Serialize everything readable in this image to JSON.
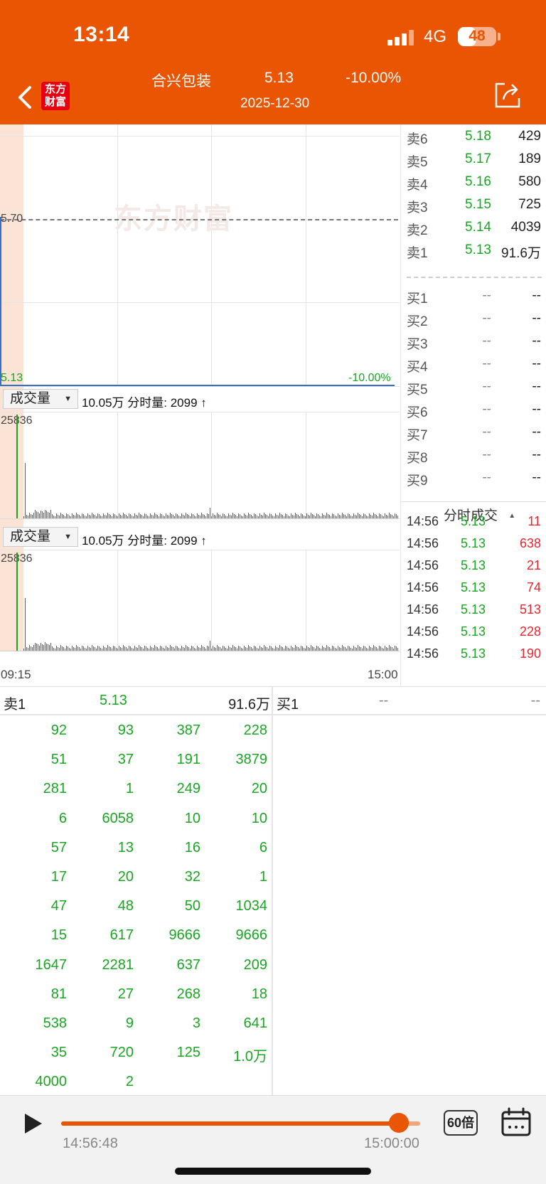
{
  "status": {
    "time": "13:14",
    "network": "4G",
    "battery": "48"
  },
  "header": {
    "logo": "东方财富",
    "stock_name": "合兴包装",
    "price": "5.13",
    "change_pct": "-10.00%",
    "date": "2025-12-30"
  },
  "chart": {
    "watermark": "东方财富",
    "price_high_label": "5.70",
    "price_low_label": "5.13",
    "pct_low_label": "-10.00%",
    "vol_select_label": "成交量",
    "vol_info": "10.05万 分时量: 2099 ↑",
    "vol_max_label": "25836",
    "time_start": "09:15",
    "time_end": "15:00"
  },
  "order_book": {
    "asks": [
      {
        "label": "卖6",
        "price": "5.18",
        "vol": "429"
      },
      {
        "label": "卖5",
        "price": "5.17",
        "vol": "189"
      },
      {
        "label": "卖4",
        "price": "5.16",
        "vol": "580"
      },
      {
        "label": "卖3",
        "price": "5.15",
        "vol": "725"
      },
      {
        "label": "卖2",
        "price": "5.14",
        "vol": "4039"
      },
      {
        "label": "卖1",
        "price": "5.13",
        "vol": "91.6万"
      }
    ],
    "bids": [
      {
        "label": "买1",
        "price": "--",
        "vol": "--"
      },
      {
        "label": "买2",
        "price": "--",
        "vol": "--"
      },
      {
        "label": "买3",
        "price": "--",
        "vol": "--"
      },
      {
        "label": "买4",
        "price": "--",
        "vol": "--"
      },
      {
        "label": "买5",
        "price": "--",
        "vol": "--"
      },
      {
        "label": "买6",
        "price": "--",
        "vol": "--"
      },
      {
        "label": "买7",
        "price": "--",
        "vol": "--"
      },
      {
        "label": "买8",
        "price": "--",
        "vol": "--"
      },
      {
        "label": "买9",
        "price": "--",
        "vol": "--"
      }
    ]
  },
  "trades": {
    "title": "分时成交",
    "rows": [
      {
        "time": "14:56",
        "price": "5.13",
        "vol": "11"
      },
      {
        "time": "14:56",
        "price": "5.13",
        "vol": "638"
      },
      {
        "time": "14:56",
        "price": "5.13",
        "vol": "21"
      },
      {
        "time": "14:56",
        "price": "5.13",
        "vol": "74"
      },
      {
        "time": "14:56",
        "price": "5.13",
        "vol": "513"
      },
      {
        "time": "14:56",
        "price": "5.13",
        "vol": "228"
      },
      {
        "time": "14:56",
        "price": "5.13",
        "vol": "190"
      }
    ]
  },
  "queue": {
    "sell_label": "卖1",
    "sell_price": "5.13",
    "sell_total": "91.6万",
    "buy_label": "买1",
    "buy_price": "--",
    "buy_total": "--",
    "rows": [
      [
        "92",
        "93",
        "387",
        "228"
      ],
      [
        "51",
        "37",
        "191",
        "3879"
      ],
      [
        "281",
        "1",
        "249",
        "20"
      ],
      [
        "6",
        "6058",
        "10",
        "10"
      ],
      [
        "57",
        "13",
        "16",
        "6"
      ],
      [
        "17",
        "20",
        "32",
        "1"
      ],
      [
        "47",
        "48",
        "50",
        "1034"
      ],
      [
        "15",
        "617",
        "9666",
        "9666"
      ],
      [
        "1647",
        "2281",
        "637",
        "209"
      ],
      [
        "81",
        "27",
        "268",
        "18"
      ],
      [
        "538",
        "9",
        "3",
        "641"
      ],
      [
        "35",
        "720",
        "125",
        "1.0万"
      ],
      [
        "4000",
        "2",
        "",
        ""
      ]
    ]
  },
  "player": {
    "start_time": "14:56:48",
    "end_time": "15:00:00",
    "speed": "60倍",
    "progress": 0.94
  },
  "colors": {
    "brand": "#ea5504",
    "up": "#e8252f",
    "down": "#1aa523"
  }
}
